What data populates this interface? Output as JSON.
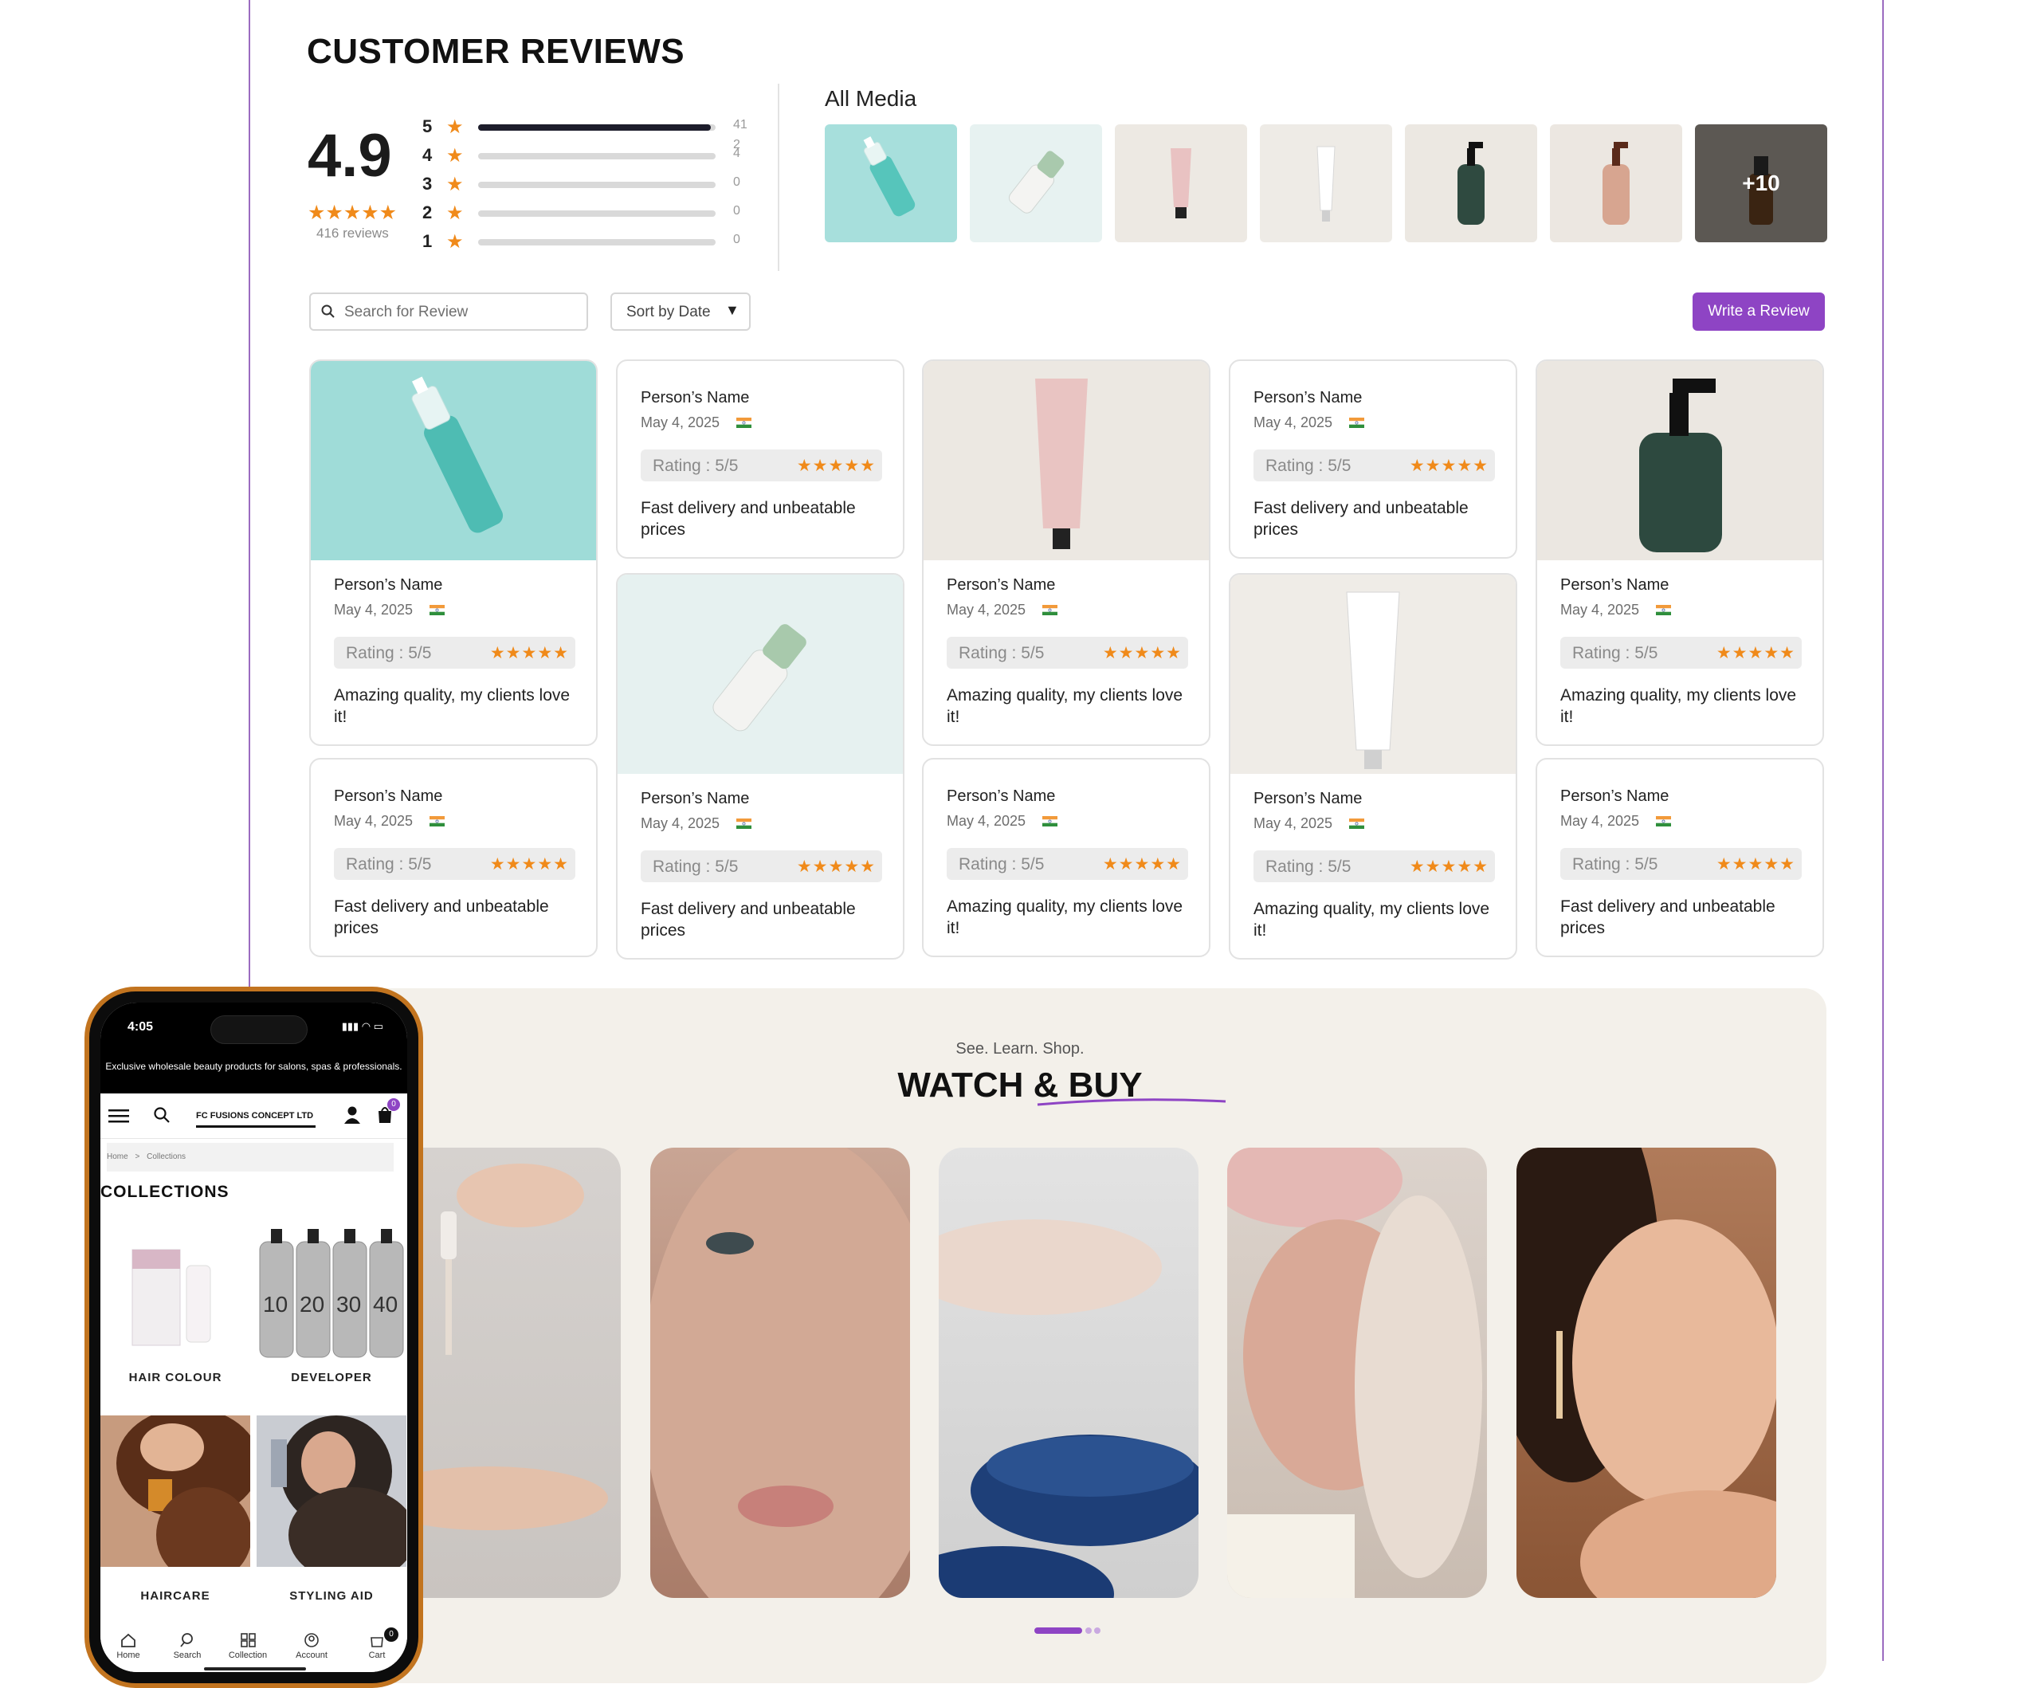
{
  "reviews": {
    "title": "CUSTOMER REVIEWS",
    "average": "4.9",
    "average_stars": "★★★★★",
    "count_label": "416 reviews",
    "distribution": [
      {
        "stars": "5",
        "count": "41",
        "fraction": 0.98
      },
      {
        "stars": "4",
        "count": "2\n4",
        "fraction": 0.0
      },
      {
        "stars": "3",
        "count": "0",
        "fraction": 0.0
      },
      {
        "stars": "2",
        "count": "0",
        "fraction": 0.0
      },
      {
        "stars": "1",
        "count": "0",
        "fraction": 0.0
      }
    ],
    "media": {
      "title": "All Media",
      "more_label": "+10"
    },
    "search_placeholder": "Search for Review",
    "sort_label": "Sort by Date",
    "write_label": "Write a Review",
    "cards": [
      {
        "name": "Person’s Name",
        "date": "May 4, 2025",
        "rating": "Rating : 5/5",
        "stars": "★★★★★",
        "text": "Amazing quality, my clients love it!"
      },
      {
        "name": "Person’s Name",
        "date": "May 4, 2025",
        "rating": "Rating : 5/5",
        "stars": "★★★★★",
        "text": "Fast delivery and unbeatable prices"
      },
      {
        "name": "Person’s Name",
        "date": "May 4, 2025",
        "rating": "Rating : 5/5",
        "stars": "★★★★★",
        "text": "Amazing quality, my clients love it!"
      },
      {
        "name": "Person’s Name",
        "date": "May 4, 2025",
        "rating": "Rating : 5/5",
        "stars": "★★★★★",
        "text": "Fast delivery and unbeatable prices"
      },
      {
        "name": "Person’s Name",
        "date": "May 4, 2025",
        "rating": "Rating : 5/5",
        "stars": "★★★★★",
        "text": "Amazing quality, my clients love it!"
      },
      {
        "name": "Person’s Name",
        "date": "May 4, 2025",
        "rating": "Rating : 5/5",
        "stars": "★★★★★",
        "text": "Fast delivery and unbeatable prices"
      },
      {
        "name": "Person’s Name",
        "date": "May 4, 2025",
        "rating": "Rating : 5/5",
        "stars": "★★★★★",
        "text": "Amazing quality, my clients love it!"
      },
      {
        "name": "Person’s Name",
        "date": "May 4, 2025",
        "rating": "Rating : 5/5",
        "stars": "★★★★★",
        "text": "Fast delivery and unbeatable prices"
      },
      {
        "name": "Person’s Name",
        "date": "May 4, 2025",
        "rating": "Rating : 5/5",
        "stars": "★★★★★",
        "text": "Amazing quality, my clients love it!"
      },
      {
        "name": "Person’s Name",
        "date": "May 4, 2025",
        "rating": "Rating : 5/5",
        "stars": "★★★★★",
        "text": "Fast delivery and unbeatable prices"
      }
    ]
  },
  "watch": {
    "subtitle": "See. Learn. Shop.",
    "title": "WATCH & BUY"
  },
  "phone": {
    "time": "4:05",
    "banner": "Exclusive wholesale beauty products for salons, spas & professionals.",
    "logo": "FC FUSIONS CONCEPT LTD",
    "cart_badge": "0",
    "breadcrumb_home": "Home",
    "breadcrumb_sep": ">",
    "breadcrumb_current": "Collections",
    "collections_title": "COLLECTIONS",
    "tiles": [
      "HAIR COLOUR",
      "DEVELOPER",
      "HAIRCARE",
      "STYLING AID"
    ],
    "tabs": [
      "Home",
      "Search",
      "Collection",
      "Account",
      "Cart"
    ],
    "tab_cart_badge": "0"
  },
  "colors": {
    "accent": "#8e44c4",
    "star": "#f08a1a",
    "phone_frame": "#c2741f"
  }
}
